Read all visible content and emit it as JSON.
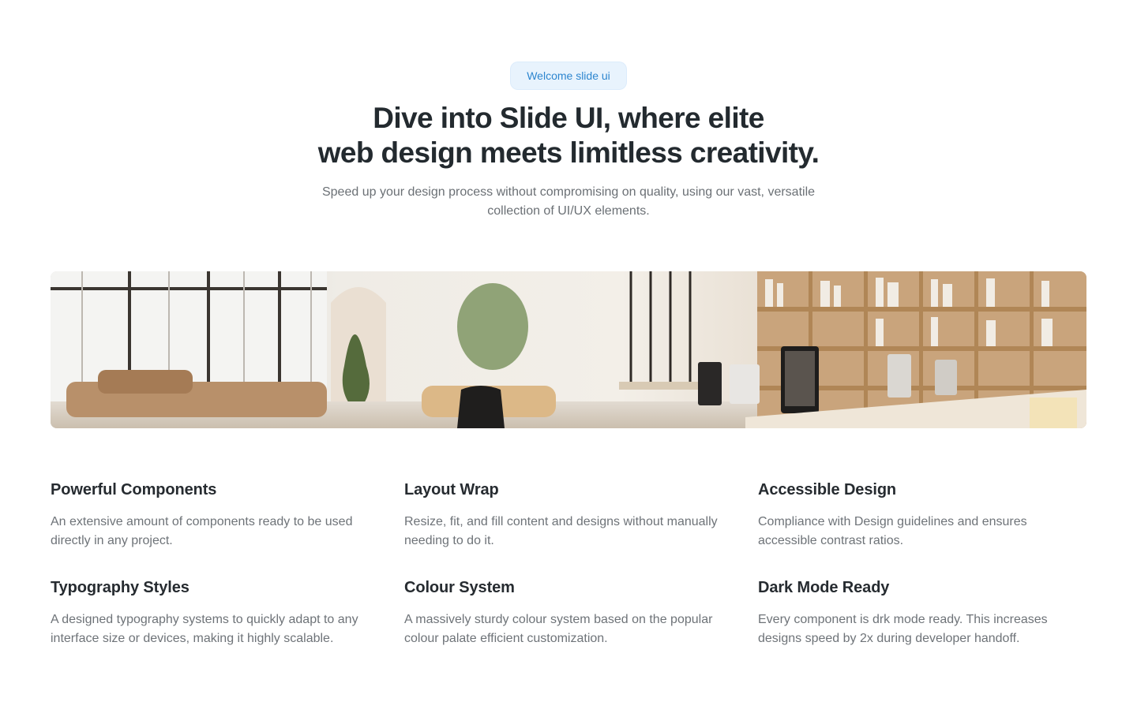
{
  "hero": {
    "badge": "Welcome slide ui",
    "headline_line1": "Dive into Slide UI, where elite",
    "headline_line2": "web design meets limitless creativity.",
    "subhead": "Speed up your design process without compromising on quality, using our vast, versatile collection of UI/UX elements."
  },
  "features": [
    {
      "title": "Powerful Components",
      "description": "An extensive amount of components ready to be used directly in any project."
    },
    {
      "title": "Layout Wrap",
      "description": "Resize, fit, and fill content and designs without manually needing to do it."
    },
    {
      "title": "Accessible Design",
      "description": "Compliance with Design guidelines and ensures accessible contrast ratios."
    },
    {
      "title": "Typography Styles",
      "description": "A designed typography systems to quickly adapt to any interface size or devices, making it highly scalable."
    },
    {
      "title": "Colour System",
      "description": "A massively sturdy colour system based on the popular colour palate efficient customization."
    },
    {
      "title": "Dark Mode Ready",
      "description": "Every component is drk mode ready. This increases designs speed by 2x during developer handoff."
    }
  ],
  "colors": {
    "badge_bg": "#e8f3fd",
    "badge_text": "#2d86cf",
    "heading": "#232a2f",
    "body_text": "#6e7378"
  }
}
